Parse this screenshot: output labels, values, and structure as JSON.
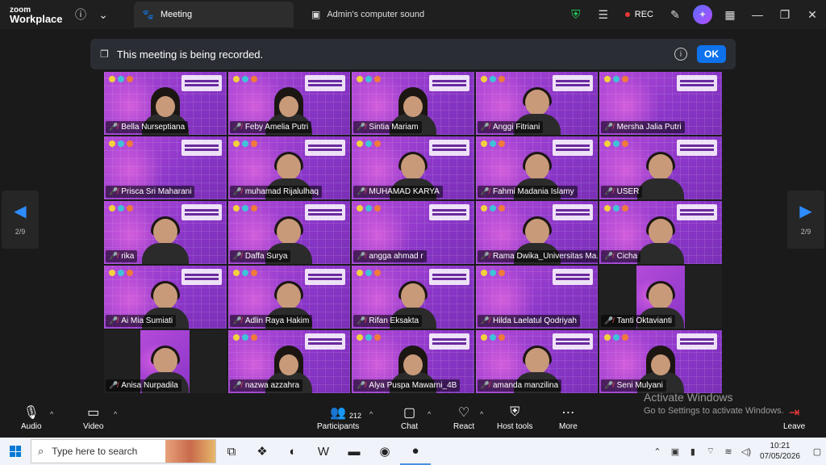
{
  "titlebar": {
    "brand_line1": "zoom",
    "brand_line2": "Workplace",
    "tab_meeting": "Meeting",
    "tab_sound": "Admin's computer sound",
    "rec_label": "REC"
  },
  "banner": {
    "text": "This meeting is being recorded.",
    "ok_label": "OK"
  },
  "pagination": {
    "left_page": "2/9",
    "right_page": "2/9"
  },
  "participants": [
    {
      "name": "Bella Nurseptiana",
      "video": "hijab"
    },
    {
      "name": "Feby Amelia Putri",
      "video": "hijab"
    },
    {
      "name": "Sintia Mariam",
      "video": "hijab"
    },
    {
      "name": "Anggi Fitriani",
      "video": "person"
    },
    {
      "name": "Mersha Jalia Putri",
      "video": "none"
    },
    {
      "name": "Prisca Sri Maharani",
      "video": "none"
    },
    {
      "name": "muhamad Rijalulhaq",
      "video": "person"
    },
    {
      "name": "MUHAMAD KARYA",
      "video": "person"
    },
    {
      "name": "Fahmi Madania Islamy",
      "video": "person"
    },
    {
      "name": "USER",
      "video": "person"
    },
    {
      "name": "rika",
      "video": "person"
    },
    {
      "name": "Daffa Surya",
      "video": "person"
    },
    {
      "name": "angga ahmad r",
      "video": "none"
    },
    {
      "name": "Rama Dwika_Universitas Ma...",
      "video": "person"
    },
    {
      "name": "Cicha",
      "video": "person"
    },
    {
      "name": "Ai Mia Sumiati",
      "video": "person"
    },
    {
      "name": "Adlin Raya Hakim",
      "video": "person"
    },
    {
      "name": "Rifan Eksakta",
      "video": "person"
    },
    {
      "name": "Hilda Laelatul Qodriyah",
      "video": "none"
    },
    {
      "name": "Tanti Oktavianti",
      "video": "dark"
    },
    {
      "name": "Anisa Nurpadila",
      "video": "dark"
    },
    {
      "name": "nazwa azzahra",
      "video": "hijab"
    },
    {
      "name": "Alya Puspa Mawarni_4B",
      "video": "hijab"
    },
    {
      "name": "amanda manzilina",
      "video": "person"
    },
    {
      "name": "Seni Mulyani",
      "video": "hijab"
    }
  ],
  "toolbar": {
    "audio": "Audio",
    "video": "Video",
    "participants": "Participants",
    "participant_count": "212",
    "chat": "Chat",
    "react": "React",
    "host_tools": "Host tools",
    "more": "More",
    "leave": "Leave"
  },
  "watermark": {
    "line1": "Activate Windows",
    "line2": "Go to Settings to activate Windows."
  },
  "taskbar": {
    "search_placeholder": "Type here to search",
    "time": "10:21",
    "date": "07/05/2026"
  },
  "colors": {
    "accent": "#0e72ed",
    "rec": "#e53935",
    "mute": "#ff4b4b",
    "shield": "#23c552"
  }
}
